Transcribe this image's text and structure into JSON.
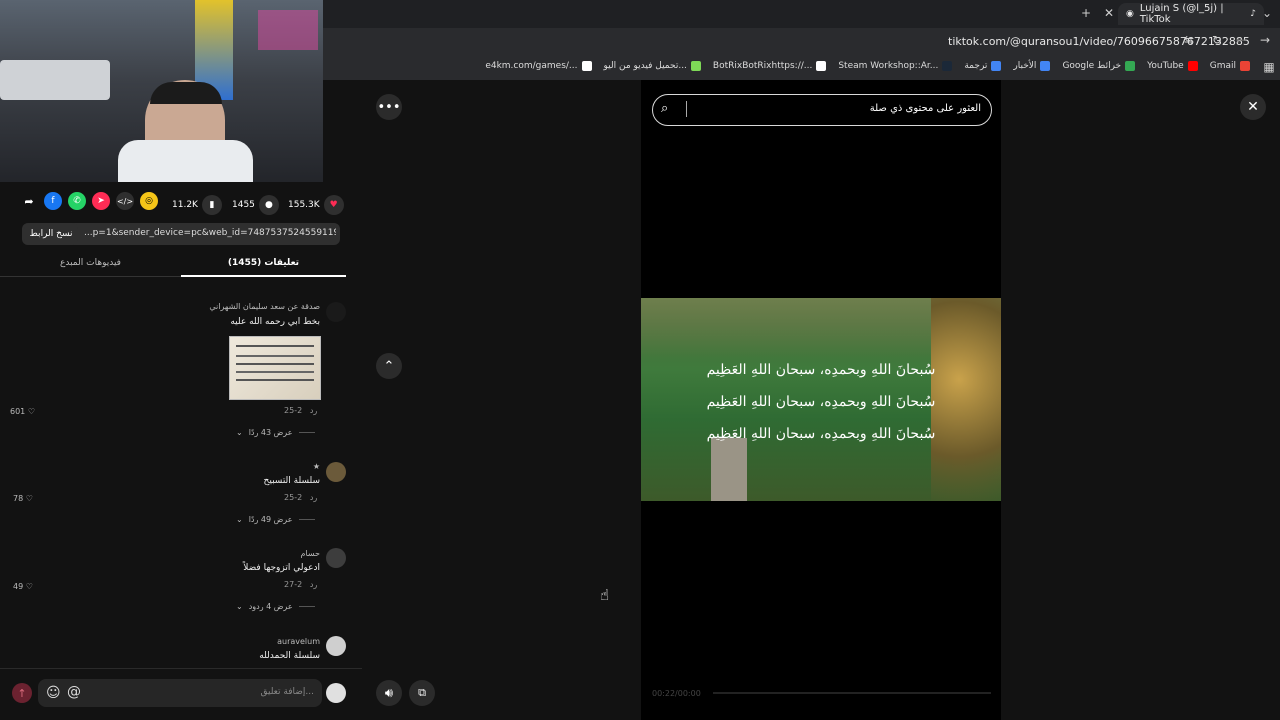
{
  "browser": {
    "tab_title": "Lujain S (@l_5j) | TikTok",
    "url": "tiktok.com/@quransou1/video/7609667587672132885",
    "bookmarks": [
      {
        "label": "Gmail",
        "color": "#ea4335"
      },
      {
        "label": "YouTube",
        "color": "#ff0000"
      },
      {
        "label": "Google خرائط",
        "color": "#34a853"
      },
      {
        "label": "الأخبار",
        "color": "#4285f4"
      },
      {
        "label": "ترجمة",
        "color": "#4285f4"
      },
      {
        "label": "Steam Workshop::Ar...",
        "color": "#1b2838"
      },
      {
        "label": "BotRixBotRixhttps://...",
        "color": "#ffffff"
      },
      {
        "label": "تحميل فيديو من اليو...",
        "color": "#7ed957"
      },
      {
        "label": "e4km.com/games/...",
        "color": "#ffffff"
      }
    ]
  },
  "post": {
    "likes": "155.3K",
    "comments_count": "1455",
    "saves": "11.2K",
    "link_text": "...p=1&sender_device=pc&web_id=7487537524559119927",
    "copy_link_label": "نسخ الرابط",
    "tabs": {
      "comments": "تعليقات (1455)",
      "creator_videos": "فيديوهات المبدع"
    }
  },
  "comments": [
    {
      "name": "صدقة عن سعد سليمان الشهراني",
      "text": "بخط ابي رحمه الله عليه",
      "date": "2-25",
      "reply": "رد",
      "likes": "601",
      "replies": "عرض 43 ردًا"
    },
    {
      "name": "★",
      "text": "سلسلة التسبيح",
      "date": "2-25",
      "reply": "رد",
      "likes": "78",
      "replies": "عرض 49 ردًا"
    },
    {
      "name": "حسام",
      "text": "ادعولي اتزوجها فضلاً",
      "date": "2-27",
      "reply": "رد",
      "likes": "49",
      "replies": "عرض 4 ردود"
    },
    {
      "name": "auravelum",
      "text": "سلسلة الحمدلله"
    }
  ],
  "composer": {
    "placeholder": "إضافة تعليق..."
  },
  "player": {
    "search_placeholder": "العثور على محتوى ذي صلة",
    "caption_lines": [
      "سُبحانَ اللهِ وبحمدِه، سبحان اللهِ العَظِيم",
      "سُبحانَ اللهِ وبحمدِه، سبحان اللهِ العَظِيم",
      "سُبحانَ اللهِ وبحمدِه، سبحان اللهِ العَظِيم"
    ],
    "time": "00:22/00:00"
  },
  "colors": {
    "like": "#fe2c55",
    "background": "#121212",
    "player": "#000000"
  }
}
